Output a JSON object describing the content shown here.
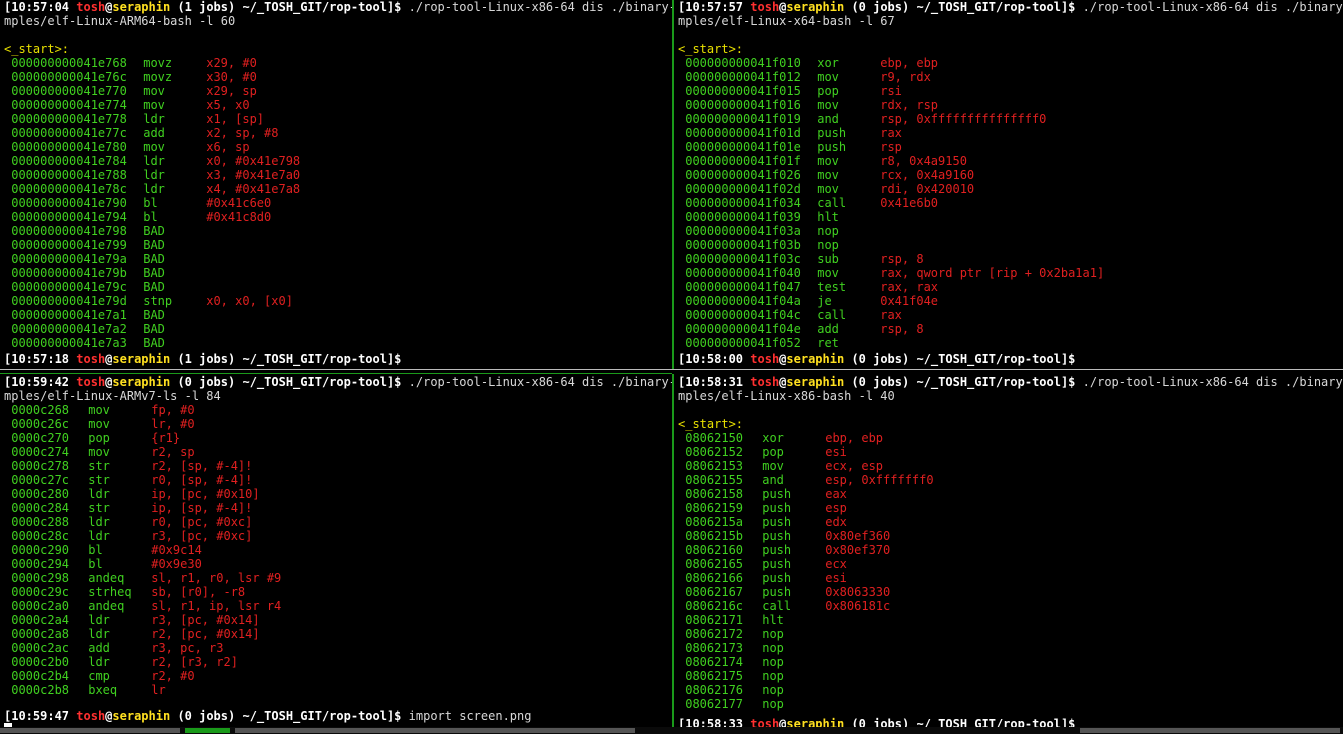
{
  "colors": {
    "accent_green": "#1a9a1a",
    "address": "#40d020",
    "operand": "#e02020",
    "user": "#ff3030",
    "host": "#ffe020"
  },
  "panes": {
    "tl": {
      "header": {
        "time": "[10:57:04",
        "user": "tosh",
        "at": "@",
        "host": "seraphin",
        "jobs": "(1 jobs)",
        "path": "~/_TOSH_GIT/rop-tool]$",
        "cmd": " ./rop-tool-Linux-x86-64 dis ./binary-sa",
        "cmd2": "mples/elf-Linux-ARM64-bash -l 60"
      },
      "label": "<_start>:",
      "rows": [
        {
          "a": "000000000041e768",
          "m": "movz",
          "o": "x29, #0"
        },
        {
          "a": "000000000041e76c",
          "m": "movz",
          "o": "x30, #0"
        },
        {
          "a": "000000000041e770",
          "m": "mov",
          "o": "x29, sp"
        },
        {
          "a": "000000000041e774",
          "m": "mov",
          "o": "x5, x0"
        },
        {
          "a": "000000000041e778",
          "m": "ldr",
          "o": "x1, [sp]"
        },
        {
          "a": "000000000041e77c",
          "m": "add",
          "o": "x2, sp, #8"
        },
        {
          "a": "000000000041e780",
          "m": "mov",
          "o": "x6, sp"
        },
        {
          "a": "000000000041e784",
          "m": "ldr",
          "o": "x0, #0x41e798"
        },
        {
          "a": "000000000041e788",
          "m": "ldr",
          "o": "x3, #0x41e7a0"
        },
        {
          "a": "000000000041e78c",
          "m": "ldr",
          "o": "x4, #0x41e7a8"
        },
        {
          "a": "000000000041e790",
          "m": "bl",
          "o": "#0x41c6e0"
        },
        {
          "a": "000000000041e794",
          "m": "bl",
          "o": "#0x41c8d0"
        },
        {
          "a": "000000000041e798",
          "m": "BAD",
          "o": ""
        },
        {
          "a": "000000000041e799",
          "m": "BAD",
          "o": ""
        },
        {
          "a": "000000000041e79a",
          "m": "BAD",
          "o": ""
        },
        {
          "a": "000000000041e79b",
          "m": "BAD",
          "o": ""
        },
        {
          "a": "000000000041e79c",
          "m": "BAD",
          "o": ""
        },
        {
          "a": "000000000041e79d",
          "m": "stnp",
          "o": "x0, x0, [x0]"
        },
        {
          "a": "000000000041e7a1",
          "m": "BAD",
          "o": ""
        },
        {
          "a": "000000000041e7a2",
          "m": "BAD",
          "o": ""
        },
        {
          "a": "000000000041e7a3",
          "m": "BAD",
          "o": ""
        }
      ],
      "footer": {
        "time": "[10:57:18",
        "user": "tosh",
        "at": "@",
        "host": "seraphin",
        "jobs": "(1 jobs)",
        "path": "~/_TOSH_GIT/rop-tool]$",
        "cmd": ""
      }
    },
    "tr": {
      "header": {
        "time": "[10:57:57",
        "user": "tosh",
        "at": "@",
        "host": "seraphin",
        "jobs": "(0 jobs)",
        "path": "~/_TOSH_GIT/rop-tool]$",
        "cmd": " ./rop-tool-Linux-x86-64 dis ./binary-sa",
        "cmd2": "mples/elf-Linux-x64-bash -l 67"
      },
      "label": "<_start>:",
      "rows": [
        {
          "a": "000000000041f010",
          "m": "xor",
          "o": "ebp, ebp"
        },
        {
          "a": "000000000041f012",
          "m": "mov",
          "o": "r9, rdx"
        },
        {
          "a": "000000000041f015",
          "m": "pop",
          "o": "rsi"
        },
        {
          "a": "000000000041f016",
          "m": "mov",
          "o": "rdx, rsp"
        },
        {
          "a": "000000000041f019",
          "m": "and",
          "o": "rsp, 0xfffffffffffffff0"
        },
        {
          "a": "000000000041f01d",
          "m": "push",
          "o": "rax"
        },
        {
          "a": "000000000041f01e",
          "m": "push",
          "o": "rsp"
        },
        {
          "a": "000000000041f01f",
          "m": "mov",
          "o": "r8, 0x4a9150"
        },
        {
          "a": "000000000041f026",
          "m": "mov",
          "o": "rcx, 0x4a9160"
        },
        {
          "a": "000000000041f02d",
          "m": "mov",
          "o": "rdi, 0x420010"
        },
        {
          "a": "000000000041f034",
          "m": "call",
          "o": "0x41e6b0"
        },
        {
          "a": "000000000041f039",
          "m": "hlt",
          "o": ""
        },
        {
          "a": "000000000041f03a",
          "m": "nop",
          "o": ""
        },
        {
          "a": "000000000041f03b",
          "m": "nop",
          "o": ""
        },
        {
          "a": "000000000041f03c",
          "m": "sub",
          "o": "rsp, 8"
        },
        {
          "a": "000000000041f040",
          "m": "mov",
          "o": "rax, qword ptr [rip + 0x2ba1a1]"
        },
        {
          "a": "000000000041f047",
          "m": "test",
          "o": "rax, rax"
        },
        {
          "a": "000000000041f04a",
          "m": "je",
          "o": "0x41f04e"
        },
        {
          "a": "000000000041f04c",
          "m": "call",
          "o": "rax"
        },
        {
          "a": "000000000041f04e",
          "m": "add",
          "o": "rsp, 8"
        },
        {
          "a": "000000000041f052",
          "m": "ret",
          "o": ""
        }
      ],
      "footer": {
        "time": "[10:58:00",
        "user": "tosh",
        "at": "@",
        "host": "seraphin",
        "jobs": "(0 jobs)",
        "path": "~/_TOSH_GIT/rop-tool]$",
        "cmd": ""
      }
    },
    "bl": {
      "header": {
        "time": "[10:59:42",
        "user": "tosh",
        "at": "@",
        "host": "seraphin",
        "jobs": "(0 jobs)",
        "path": "~/_TOSH_GIT/rop-tool]$",
        "cmd": " ./rop-tool-Linux-x86-64 dis ./binary-sa",
        "cmd2": "mples/elf-Linux-ARMv7-ls -l 84"
      },
      "label": "",
      "rows": [
        {
          "a": "0000c268",
          "m": "mov",
          "o": "fp, #0"
        },
        {
          "a": "0000c26c",
          "m": "mov",
          "o": "lr, #0"
        },
        {
          "a": "0000c270",
          "m": "pop",
          "o": "{r1}"
        },
        {
          "a": "0000c274",
          "m": "mov",
          "o": "r2, sp"
        },
        {
          "a": "0000c278",
          "m": "str",
          "o": "r2, [sp, #-4]!"
        },
        {
          "a": "0000c27c",
          "m": "str",
          "o": "r0, [sp, #-4]!"
        },
        {
          "a": "0000c280",
          "m": "ldr",
          "o": "ip, [pc, #0x10]"
        },
        {
          "a": "0000c284",
          "m": "str",
          "o": "ip, [sp, #-4]!"
        },
        {
          "a": "0000c288",
          "m": "ldr",
          "o": "r0, [pc, #0xc]"
        },
        {
          "a": "0000c28c",
          "m": "ldr",
          "o": "r3, [pc, #0xc]"
        },
        {
          "a": "0000c290",
          "m": "bl",
          "o": "#0x9c14"
        },
        {
          "a": "0000c294",
          "m": "bl",
          "o": "#0x9e30"
        },
        {
          "a": "0000c298",
          "m": "andeq",
          "o": "sl, r1, r0, lsr #9"
        },
        {
          "a": "0000c29c",
          "m": "strheq",
          "o": "sb, [r0], -r8"
        },
        {
          "a": "0000c2a0",
          "m": "andeq",
          "o": "sl, r1, ip, lsr r4"
        },
        {
          "a": "0000c2a4",
          "m": "ldr",
          "o": "r3, [pc, #0x14]"
        },
        {
          "a": "0000c2a8",
          "m": "ldr",
          "o": "r2, [pc, #0x14]"
        },
        {
          "a": "0000c2ac",
          "m": "add",
          "o": "r3, pc, r3"
        },
        {
          "a": "0000c2b0",
          "m": "ldr",
          "o": "r2, [r3, r2]"
        },
        {
          "a": "0000c2b4",
          "m": "cmp",
          "o": "r2, #0"
        },
        {
          "a": "0000c2b8",
          "m": "bxeq",
          "o": "lr"
        }
      ],
      "footer": {
        "time": "[10:59:47",
        "user": "tosh",
        "at": "@",
        "host": "seraphin",
        "jobs": "(0 jobs)",
        "path": "~/_TOSH_GIT/rop-tool]$",
        "cmd": " import screen.png"
      }
    },
    "br": {
      "header": {
        "time": "[10:58:31",
        "user": "tosh",
        "at": "@",
        "host": "seraphin",
        "jobs": "(0 jobs)",
        "path": "~/_TOSH_GIT/rop-tool]$",
        "cmd": " ./rop-tool-Linux-x86-64 dis ./binary-sa",
        "cmd2": "mples/elf-Linux-x86-bash -l 40"
      },
      "label": "<_start>:",
      "rows": [
        {
          "a": "08062150",
          "m": "xor",
          "o": "ebp, ebp"
        },
        {
          "a": "08062152",
          "m": "pop",
          "o": "esi"
        },
        {
          "a": "08062153",
          "m": "mov",
          "o": "ecx, esp"
        },
        {
          "a": "08062155",
          "m": "and",
          "o": "esp, 0xfffffff0"
        },
        {
          "a": "08062158",
          "m": "push",
          "o": "eax"
        },
        {
          "a": "08062159",
          "m": "push",
          "o": "esp"
        },
        {
          "a": "0806215a",
          "m": "push",
          "o": "edx"
        },
        {
          "a": "0806215b",
          "m": "push",
          "o": "0x80ef360"
        },
        {
          "a": "08062160",
          "m": "push",
          "o": "0x80ef370"
        },
        {
          "a": "08062165",
          "m": "push",
          "o": "ecx"
        },
        {
          "a": "08062166",
          "m": "push",
          "o": "esi"
        },
        {
          "a": "08062167",
          "m": "push",
          "o": "0x8063330"
        },
        {
          "a": "0806216c",
          "m": "call",
          "o": "0x806181c"
        },
        {
          "a": "08062171",
          "m": "hlt",
          "o": ""
        },
        {
          "a": "08062172",
          "m": "nop",
          "o": ""
        },
        {
          "a": "08062173",
          "m": "nop",
          "o": ""
        },
        {
          "a": "08062174",
          "m": "nop",
          "o": ""
        },
        {
          "a": "08062175",
          "m": "nop",
          "o": ""
        },
        {
          "a": "08062176",
          "m": "nop",
          "o": ""
        },
        {
          "a": "08062177",
          "m": "nop",
          "o": ""
        }
      ],
      "footer": {
        "time": "[10:58:33",
        "user": "tosh",
        "at": "@",
        "host": "seraphin",
        "jobs": "(0 jobs)",
        "path": "~/_TOSH_GIT/rop-tool]$",
        "cmd": ""
      }
    }
  }
}
